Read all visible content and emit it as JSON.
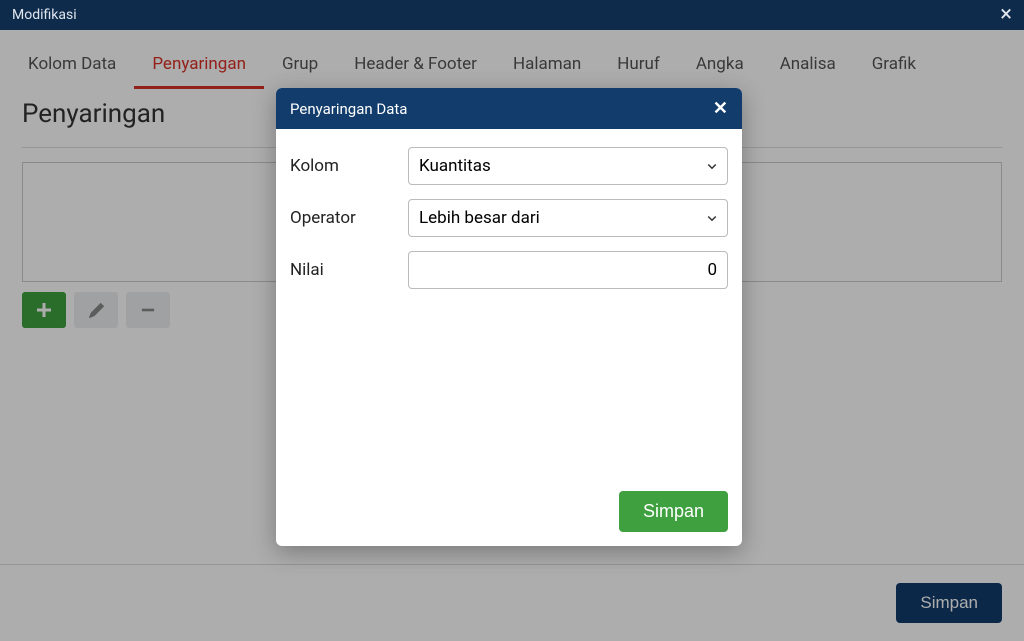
{
  "window": {
    "title": "Modifikasi"
  },
  "tabs": {
    "items": [
      {
        "label": "Kolom Data",
        "active": false
      },
      {
        "label": "Penyaringan",
        "active": true
      },
      {
        "label": "Grup",
        "active": false
      },
      {
        "label": "Header & Footer",
        "active": false
      },
      {
        "label": "Halaman",
        "active": false
      },
      {
        "label": "Huruf",
        "active": false
      },
      {
        "label": "Angka",
        "active": false
      },
      {
        "label": "Analisa",
        "active": false
      },
      {
        "label": "Grafik",
        "active": false
      }
    ]
  },
  "section": {
    "title": "Penyaringan"
  },
  "footer": {
    "save_label": "Simpan"
  },
  "dialog": {
    "title": "Penyaringan Data",
    "labels": {
      "kolom": "Kolom",
      "operator": "Operator",
      "nilai": "Nilai"
    },
    "values": {
      "kolom": "Kuantitas",
      "operator": "Lebih besar dari",
      "nilai": "0"
    },
    "save_label": "Simpan"
  }
}
